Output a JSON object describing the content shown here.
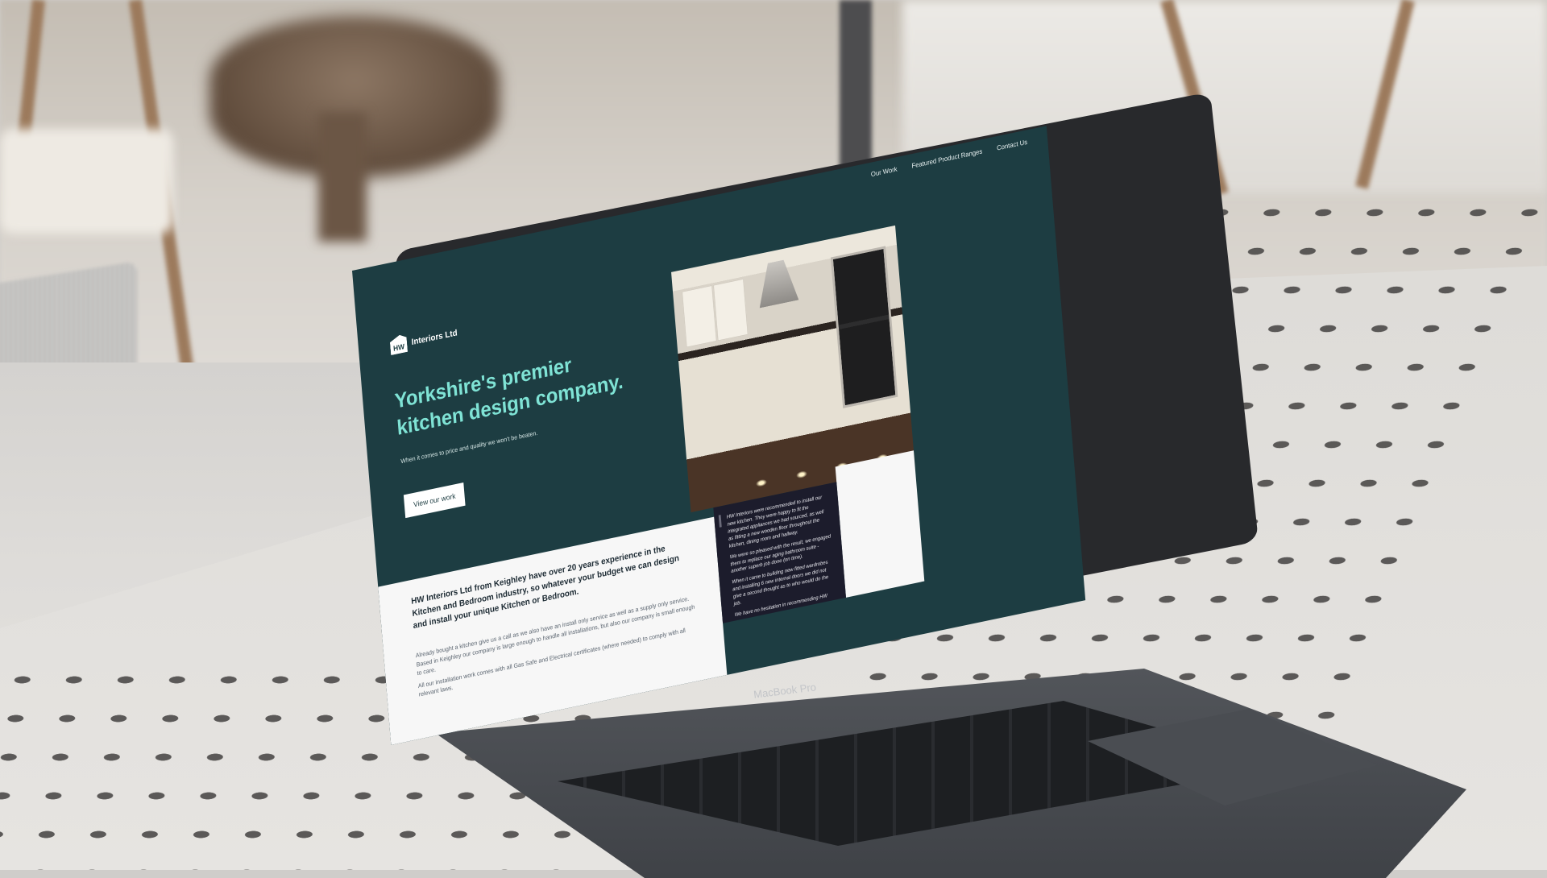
{
  "site": {
    "nav": [
      "Our Work",
      "Featured Product Ranges",
      "Contact Us"
    ],
    "logo_mark": "HW",
    "logo_text": "Interiors Ltd",
    "hero_title": "Yorkshire's premier kitchen design company.",
    "hero_subtitle": "When it comes to price and quality we won't be beaten.",
    "hero_button": "View our work",
    "intro": "HW Interiors Ltd from Keighley have over 20 years experience in the Kitchen and Bedroom industry, so whatever your budget we can design and install your unique Kitchen or Bedroom.",
    "body": [
      "Already bought a kitchen give us a call as we also have an install only service as well as a supply only service. Based in Keighley our company is large enough to handle all installations, but also our company is small enough to care.",
      "All our installation work comes with all Gas Safe and Electrical certificates (where needed) to comply with all relevant laws."
    ],
    "testimonial": [
      "HW Interiors were recommended to install our new kitchen. They were happy to fit the integrated appliances we had sourced, as well as fitting a new wooden floor throughout the kitchen, dining room and hallway.",
      "We were so pleased with the result, we engaged them to replace our aging bathroom suite - another superb job done (on time).",
      "When it came to building new fitted wardrobes and installing 6 new internal doors we did not give a second thought as to who would do the job.",
      "We have no hesitation in recommending HW"
    ]
  },
  "device": {
    "label": "MacBook Pro"
  },
  "colors": {
    "site_background": "#1d3d42",
    "accent_title": "#7fe3d5",
    "testimonial_bg": "#1c1c2c"
  }
}
